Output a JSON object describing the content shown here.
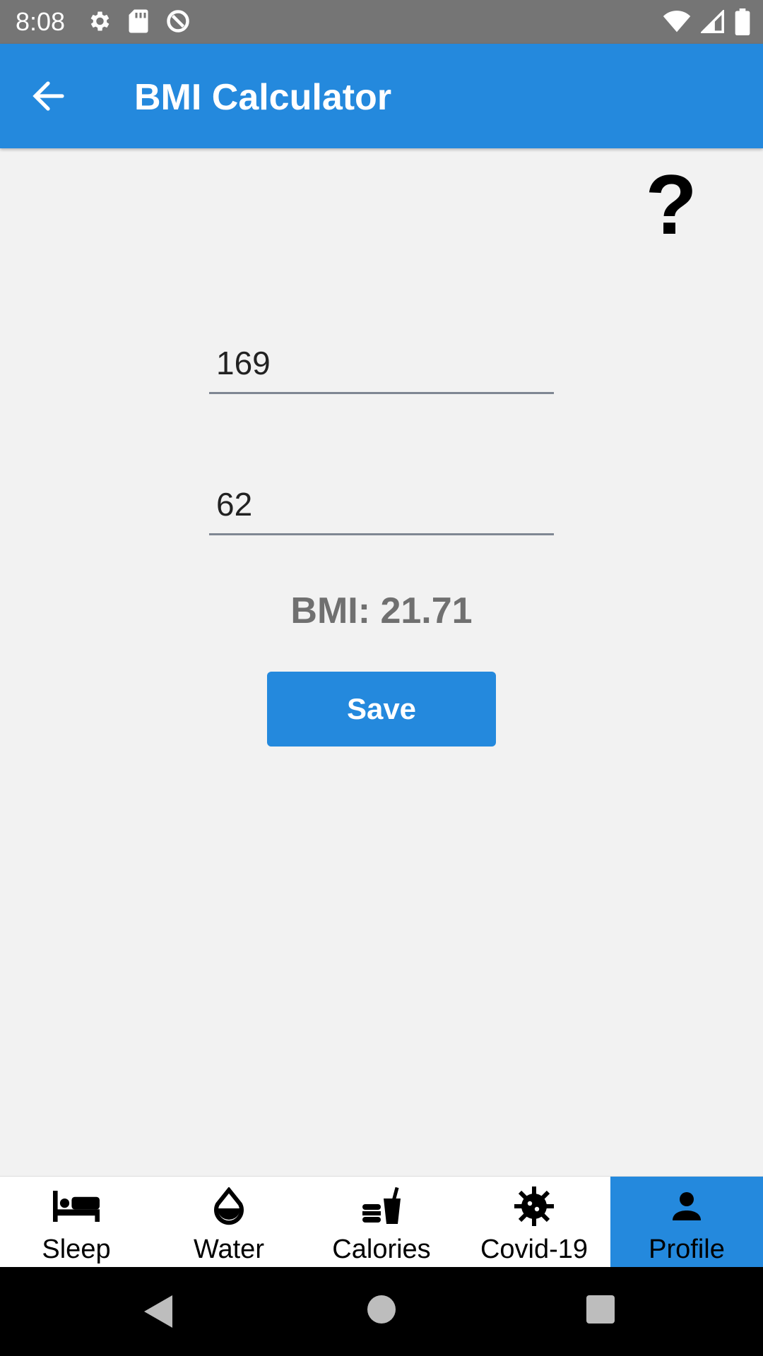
{
  "status_bar": {
    "time": "8:08"
  },
  "app_bar": {
    "title": "BMI Calculator"
  },
  "help": {
    "label": "?"
  },
  "form": {
    "height_value": "169",
    "weight_value": "62"
  },
  "result": {
    "text": "BMI: 21.71"
  },
  "save_button": {
    "label": "Save"
  },
  "bottom_nav": {
    "items": [
      {
        "label": "Sleep",
        "icon": "bed-icon"
      },
      {
        "label": "Water",
        "icon": "water-drop-icon"
      },
      {
        "label": "Calories",
        "icon": "food-drink-icon"
      },
      {
        "label": "Covid-19",
        "icon": "virus-icon"
      },
      {
        "label": "Profile",
        "icon": "person-icon",
        "active": true
      }
    ]
  },
  "colors": {
    "accent": "#2489dd",
    "status_bar": "#757575",
    "background": "#f2f2f2",
    "result_text": "#707070"
  }
}
